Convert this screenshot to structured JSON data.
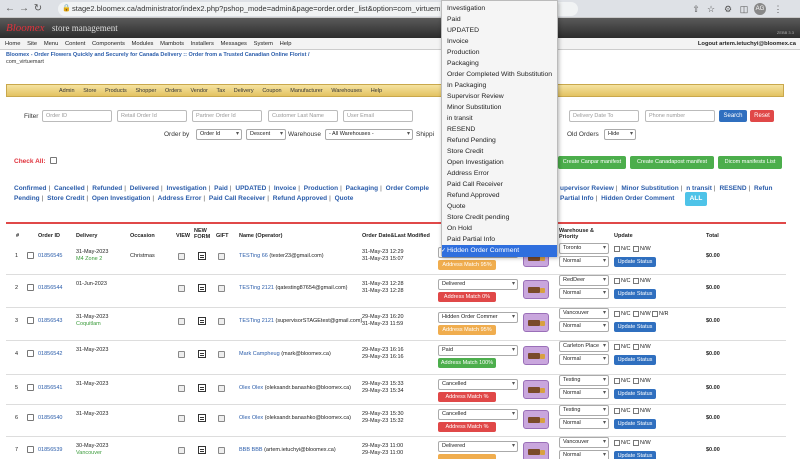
{
  "browser": {
    "url": "stage2.bloomex.ca/administrator/index2.php?pshop_mode=admin&page=order.order_list&option=com_virtuem",
    "avatar": "AG"
  },
  "brand": {
    "logo": "Bloomex",
    "subtitle": "store management",
    "version": "ZEBB 3.3"
  },
  "menu": {
    "items": [
      "Home",
      "Site",
      "Menu",
      "Content",
      "Components",
      "Modules",
      "Mambots",
      "Installers",
      "Messages",
      "System",
      "Help"
    ],
    "logout": "Logout artem.ietuchyi@bloomex.ca"
  },
  "breadcrumb": {
    "line1": "Bloomex - Order Flowers Quickly and Securely for Canada Delivery :: Order from a Trusted Canadian Online Florist /",
    "line2": "com_virtuemart"
  },
  "submenu": [
    "Admin",
    "Store",
    "Products",
    "Shopper",
    "Orders",
    "Vendor",
    "Tax",
    "Delivery",
    "Coupon",
    "Manufacturer",
    "Warehouses",
    "Help"
  ],
  "filter": {
    "label": "Filter",
    "order_id": "Order ID",
    "retail_order_id": "Retail Order Id",
    "partner_order_id": "Partner Order Id",
    "customer_last_name": "Customer Last Name",
    "user_email": "User Email",
    "delivery_date_to": "Delivery Date To",
    "phone_number": "Phone number",
    "search": "Search",
    "reset": "Reset"
  },
  "orderby": {
    "label": "Order by",
    "field": "Order Id",
    "dir": "Descent",
    "warehouse_label": "Warehouse",
    "warehouse": "- All Warehouses -",
    "shipping_label": "Shippi",
    "old_orders_label": "Old Orders",
    "old_orders": "Hide"
  },
  "manifest": {
    "btn1": "Create Canpar manifest",
    "btn2": "Create Canadapost manifest",
    "btn3": "Dicom manifests List"
  },
  "check_all": "Check All:",
  "status_links_row1": [
    "Confirmed",
    "Cancelled",
    "Refunded",
    "Delivered",
    "Investigation",
    "Paid",
    "UPDATED",
    "Invoice",
    "Production",
    "Packaging",
    "Order Comple"
  ],
  "status_links_row1b": [
    "upervisor Review",
    "Minor Substitution",
    "n transit",
    "RESEND",
    "Refun"
  ],
  "status_links_row2": [
    "Pending",
    "Store Credit",
    "Open Investigation",
    "Address Error",
    "Paid Call Receiver",
    "Refund Approved",
    "Quote"
  ],
  "status_links_row2b": [
    "Partial Info",
    "Hidden Order Comment"
  ],
  "all_button": "ALL",
  "table": {
    "headers": {
      "num": "#",
      "order_id": "Order ID",
      "delivery": "Delivery",
      "occasion": "Occasion",
      "view": "VIEW",
      "new_form": "NEW FORM",
      "gift": "GIFT",
      "name": "Name (Operator)",
      "order_date": "Order Date&Last Modified",
      "warehouse": "Warehouse & Priority",
      "update": "Update",
      "total": "Total"
    },
    "rows": [
      {
        "num": "1",
        "order_id": "01856545",
        "delivery": "31-May-2023",
        "delivery2": "M4 Zone 2",
        "occasion": "Christmas",
        "name": "TESTing 66",
        "email": "(tester23@gmail.com)",
        "date1": "31-May-23 12:29",
        "date2": "31-May-23 15:07",
        "status": "",
        "match": "Address Match 95%",
        "match_color": "orange",
        "warehouse": "Toronto",
        "priority": "Normal",
        "total": "$0.00"
      },
      {
        "num": "2",
        "order_id": "01856544",
        "delivery": "01-Jun-2023",
        "delivery2": "",
        "occasion": "",
        "name": "TESTing 2121",
        "email": "(qatesting87654@gmail.com)",
        "date1": "31-May-23 12:28",
        "date2": "31-May-23 12:28",
        "status": "Delivered",
        "match": "Address Match 0%",
        "match_color": "red",
        "warehouse": "RedDeer",
        "priority": "Normal",
        "total": "$0.00"
      },
      {
        "num": "3",
        "order_id": "01856543",
        "delivery": "31-May-2023",
        "delivery2": "Coquitlam",
        "occasion": "",
        "name": "TESTing 2121",
        "email": "(supervisorSTAGEtest@gmail.com)",
        "date1": "29-May-23 16:20",
        "date2": "31-May-23 11:59",
        "status": "Hidden Order Commer",
        "match": "Address Match 95%",
        "match_color": "orange",
        "warehouse": "Vancouver",
        "priority": "Normal",
        "total": "$0.00"
      },
      {
        "num": "4",
        "order_id": "01856542",
        "delivery": "31-May-2023",
        "delivery2": "",
        "occasion": "",
        "name": "Mark Campheug",
        "email": "(mark@bloomex.ca)",
        "date1": "29-May-23 16:16",
        "date2": "29-May-23 16:16",
        "status": "Paid",
        "match": "Address Match 100%",
        "match_color": "green",
        "warehouse": "Carleton Place",
        "priority": "Normal",
        "total": "$0.00"
      },
      {
        "num": "5",
        "order_id": "01856541",
        "delivery": "31-May-2023",
        "delivery2": "",
        "occasion": "",
        "name": "Olex Olex",
        "email": "(oleksandr.banashko@bloomex.ca)",
        "date1": "29-May-23 15:33",
        "date2": "29-May-23 15:34",
        "status": "Cancelled",
        "match": "Address Match %",
        "match_color": "red",
        "warehouse": "Testing",
        "priority": "Normal",
        "total": "$0.00"
      },
      {
        "num": "6",
        "order_id": "01856540",
        "delivery": "31-May-2023",
        "delivery2": "",
        "occasion": "",
        "name": "Olex Olex",
        "email": "(oleksandr.banashko@bloomex.ca)",
        "date1": "29-May-23 15:30",
        "date2": "29-May-23 15:32",
        "status": "Cancelled",
        "match": "Address Match %",
        "match_color": "red",
        "warehouse": "Testing",
        "priority": "Normal",
        "total": "$0.00"
      },
      {
        "num": "7",
        "order_id": "01856539",
        "delivery": "30-May-2023",
        "delivery2": "Vancouver",
        "occasion": "",
        "name": "BBB BBB",
        "email": "(artem.ietuchyi@bloomex.ca)",
        "date1": "29-May-23 11:00",
        "date2": "29-May-23 11:00",
        "status": "Delivered",
        "match": "",
        "match_color": "orange",
        "warehouse": "Vancouver",
        "priority": "Normal",
        "total": "$0.00"
      }
    ]
  },
  "dropdown": {
    "items": [
      "Investigation",
      "Paid",
      "UPDATED",
      "Invoice",
      "Production",
      "Packaging",
      "Order Completed With Substitution",
      "In Packaging",
      "Supervisor Review",
      "Minor Substitution",
      "in transit",
      "RESEND",
      "Refund Pending",
      "Store Credit",
      "Open Investigation",
      "Address Error",
      "Paid Call Receiver",
      "Refund Approved",
      "Quote",
      "Store Credit pending",
      "On Hold",
      "Paid Partial Info",
      "Hidden Order Comment"
    ],
    "selected_index": 22
  },
  "update_label": "Update Status",
  "ck_labels": {
    "nc": "N/C",
    "nw": "N/W",
    "nr": "N/R"
  },
  "colors": {
    "accent": "#2f6fbf",
    "danger": "#e04848",
    "success": "#4cae4c",
    "warning": "#f0ad4e",
    "link": "#2a5caa"
  }
}
